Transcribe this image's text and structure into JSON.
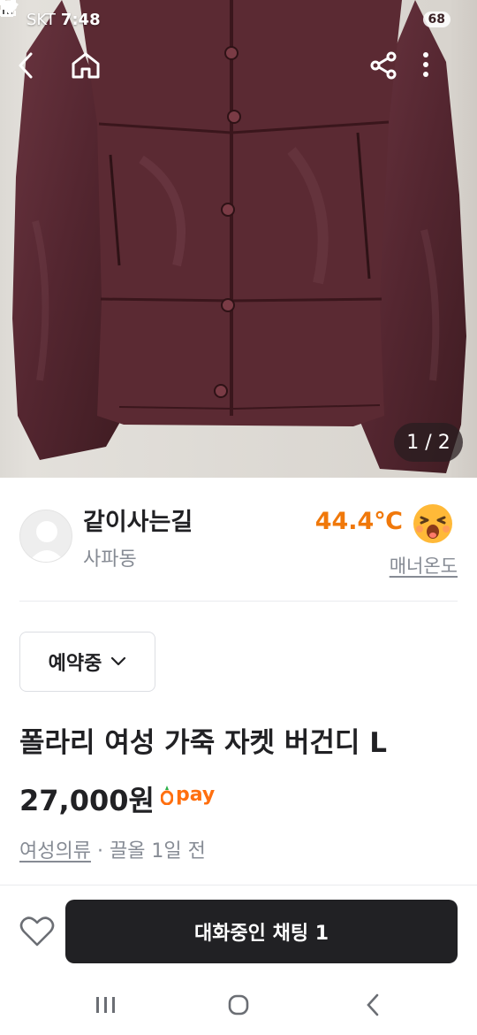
{
  "status_bar": {
    "carrier": "SKT",
    "time": "7:48",
    "notification_icons": [
      "talk-icon",
      "screenshot-icon",
      "pdf-icon",
      "dot-icon"
    ],
    "battery": "68"
  },
  "photo": {
    "counter": "1 / 2",
    "colors": {
      "leather": "#5a2a31",
      "leather_dark": "#3a1a1f",
      "wall": "#dcd9d4"
    }
  },
  "seller": {
    "name": "같이사는길",
    "location": "사파동",
    "temperature": "44.4℃",
    "manner_label": "매너온도",
    "temperature_color": "#f0780a"
  },
  "product": {
    "status": "예약중",
    "title": "폴라리 여성 가죽 자켓 버건디 L",
    "price": "27,000원",
    "pay_label": "pay",
    "category": "여성의류",
    "separator": " · ",
    "posted": "끌올 1일 전"
  },
  "bottom_bar": {
    "chat_button": "대화중인 채팅 1"
  }
}
